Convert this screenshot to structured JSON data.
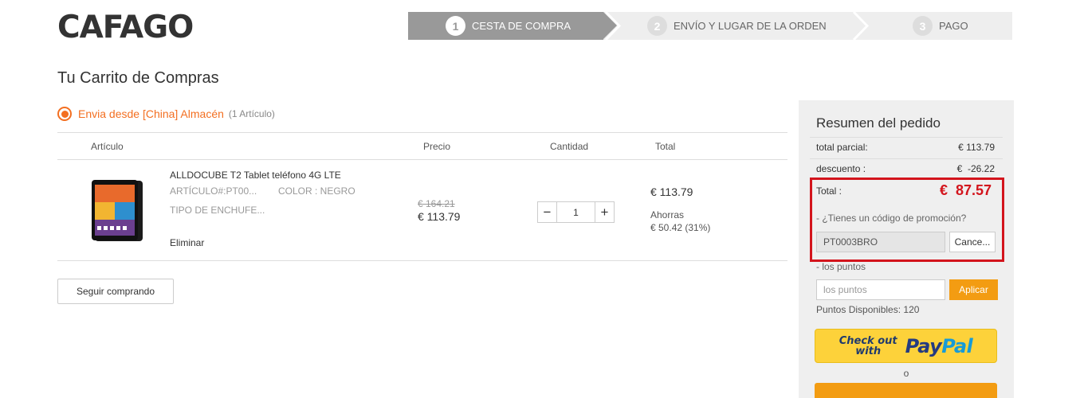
{
  "header": {
    "logo_text": "CAFAGO",
    "steps": [
      {
        "number": "1",
        "label": "CESTA DE COMPRA"
      },
      {
        "number": "2",
        "label": "ENVÍO Y LUGAR DE LA ORDEN"
      },
      {
        "number": "3",
        "label": "PAGO"
      }
    ]
  },
  "page": {
    "title": "Tu Carrito de Compras"
  },
  "warehouse": {
    "label": "Envia desde [China] Almacén",
    "count": "(1 Artículo)"
  },
  "table": {
    "headers": {
      "item": "Artículo",
      "price": "Precio",
      "quantity": "Cantidad",
      "total": "Total"
    }
  },
  "product": {
    "name": "ALLDOCUBE T2 Tablet teléfono 4G LTE",
    "sku": "ARTÍCULO#:PT00...",
    "color": "COLOR : NEGRO",
    "plug": "TIPO DE ENCHUFE...",
    "remove_label": "Eliminar",
    "price_old": "€ 164.21",
    "price_new": "€ 113.79",
    "quantity": "1",
    "minus": "−",
    "plus": "+",
    "total": "€ 113.79",
    "savings_label": "Ahorras",
    "savings_value": "€ 50.42 (31%)"
  },
  "actions": {
    "continue_label": "Seguir comprando"
  },
  "summary": {
    "title": "Resumen del pedido",
    "subtotal_label": "total parcial:",
    "subtotal_value": "€ 113.79",
    "discount_label": "descuento :",
    "discount_value": "€  -26.22",
    "total_label": "Total :",
    "total_value": "€  87.57",
    "promo_label": "- ¿Tienes un código de promoción?",
    "promo_code": "PT0003BRO",
    "cancel_label": "Cance...",
    "points_label": "- los puntos",
    "points_placeholder": "los puntos",
    "apply_label": "Aplicar",
    "points_available": "Puntos Disponibles: 120",
    "paypal_check": "Check out",
    "paypal_with": "with",
    "paypal_pay": "Pay",
    "paypal_pal": "Pal",
    "or_text": "o"
  },
  "colors": {
    "accent": "#f36f21",
    "highlight": "#d3141c",
    "apply": "#f39c12",
    "paypal_yellow": "#fdd23a"
  }
}
